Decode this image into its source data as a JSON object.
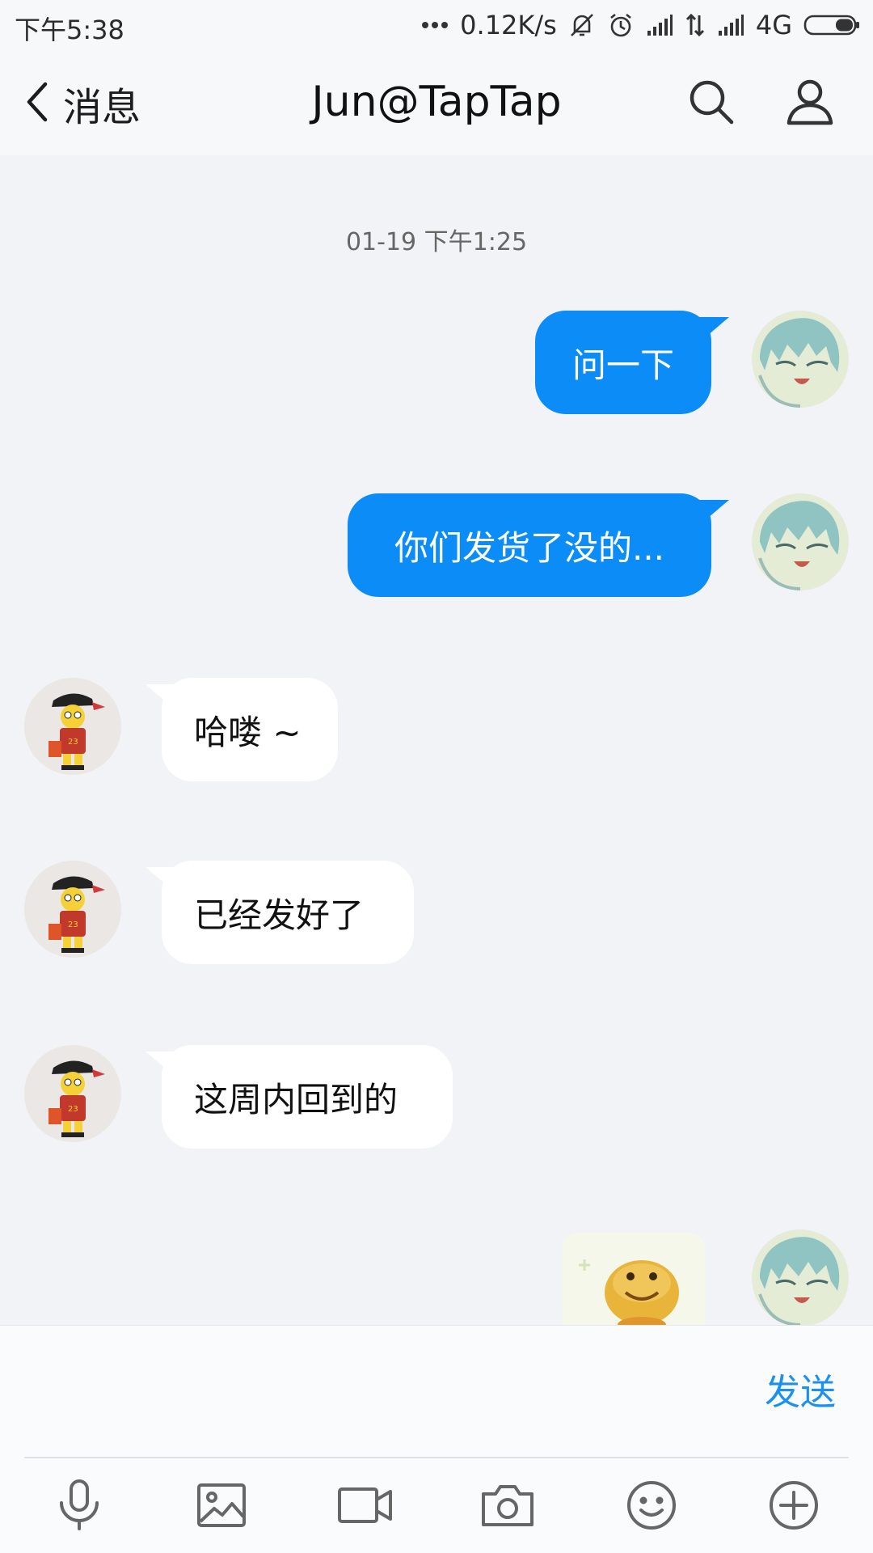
{
  "status_bar": {
    "time": "下午5:38",
    "net_speed": "0.12K/s",
    "network_type": "4G",
    "icons": [
      "more-dots-icon",
      "bell-muted-icon",
      "alarm-icon",
      "signal-icon",
      "data-arrows-icon",
      "signal-icon",
      "battery-icon"
    ]
  },
  "header": {
    "back_label": "消息",
    "title": "Jun@TapTap",
    "icons": [
      "back-chevron-icon",
      "search-icon",
      "profile-icon"
    ]
  },
  "chat": {
    "timestamp": "01-19 下午1:25",
    "messages": [
      {
        "direction": "out",
        "text": "问一下"
      },
      {
        "direction": "out",
        "text": "你们发货了没的..."
      },
      {
        "direction": "in",
        "text": "哈喽 ~"
      },
      {
        "direction": "in",
        "text": "已经发好了"
      },
      {
        "direction": "in",
        "text": "这周内回到的"
      },
      {
        "direction": "out",
        "type": "sticker"
      }
    ]
  },
  "input": {
    "value": "",
    "send_label": "发送",
    "toolbar": [
      "microphone-icon",
      "image-icon",
      "video-icon",
      "camera-icon",
      "emoji-icon",
      "plus-icon"
    ]
  },
  "colors": {
    "outgoing_bubble": "#0c8cf7",
    "incoming_bubble": "#ffffff",
    "background": "#f2f3f6",
    "send_text": "#1a90f2"
  }
}
